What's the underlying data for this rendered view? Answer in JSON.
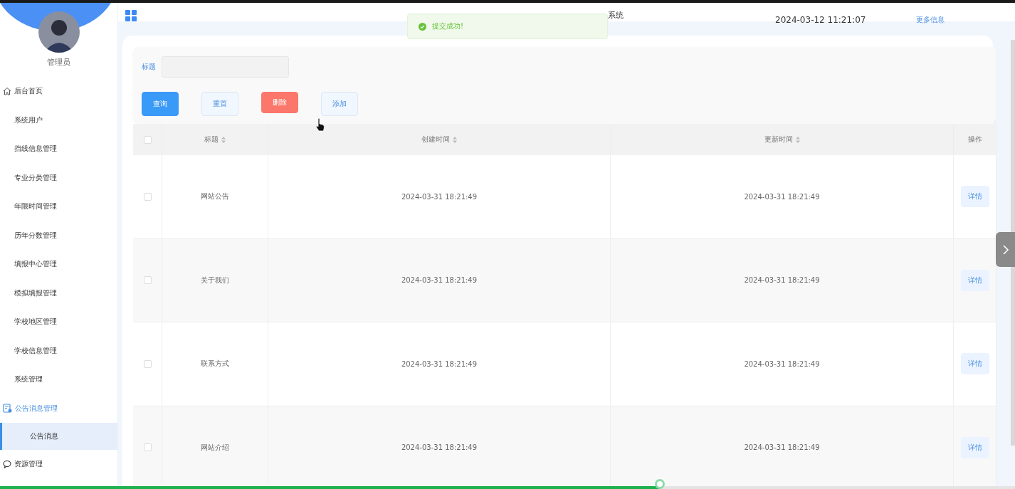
{
  "sidebar": {
    "user": "管理员",
    "items": [
      {
        "label": "后台首页",
        "selected": false
      },
      {
        "label": "系统用户",
        "selected": false
      },
      {
        "label": "挡线信息管理",
        "selected": false
      },
      {
        "label": "专业分类管理",
        "selected": false
      },
      {
        "label": "年限时间管理",
        "selected": false
      },
      {
        "label": "历年分数管理",
        "selected": false
      },
      {
        "label": "填报中心管理",
        "selected": false
      },
      {
        "label": "模拟填报管理",
        "selected": false
      },
      {
        "label": "学校地区管理",
        "selected": false
      },
      {
        "label": "学校信息管理",
        "selected": false
      },
      {
        "label": "系统管理",
        "selected": false
      },
      {
        "label": "公告消息管理",
        "selected": false,
        "children": [
          {
            "label": "公告消息",
            "selected": true
          }
        ]
      },
      {
        "label": "资源管理",
        "selected": false
      }
    ]
  },
  "header": {
    "title": "系统",
    "datetime": "2024-03-12 11:21:07",
    "more_link": "更多信息"
  },
  "toast": {
    "message": "提交成功!"
  },
  "search": {
    "label": "标题",
    "buttons": [
      {
        "label": "查询",
        "kind": "primary"
      },
      {
        "label": "重置",
        "kind": "plain"
      },
      {
        "label": "删除",
        "kind": "danger"
      },
      {
        "label": "添加",
        "kind": "plain"
      }
    ]
  },
  "table": {
    "select_all_checked": false,
    "columns": [
      "标题",
      "创建时间",
      "更新时间",
      "操作"
    ],
    "rows": [
      {
        "title": "网站公告",
        "created": "2024-03-31 18:21:49",
        "updated": "2024-03-31 18:21:49",
        "action": "详情",
        "checked": false
      },
      {
        "title": "关于我们",
        "created": "2024-03-31 18:21:49",
        "updated": "2024-03-31 18:21:49",
        "action": "详情",
        "checked": false
      },
      {
        "title": "联系方式",
        "created": "2024-03-31 18:21:49",
        "updated": "2024-03-31 18:21:49",
        "action": "详情",
        "checked": false
      },
      {
        "title": "网站介绍",
        "created": "2024-03-31 18:21:49",
        "updated": "2024-03-31 18:21:49",
        "action": "详情",
        "checked": false
      }
    ]
  },
  "playback_bar": {
    "level": 0.65
  }
}
